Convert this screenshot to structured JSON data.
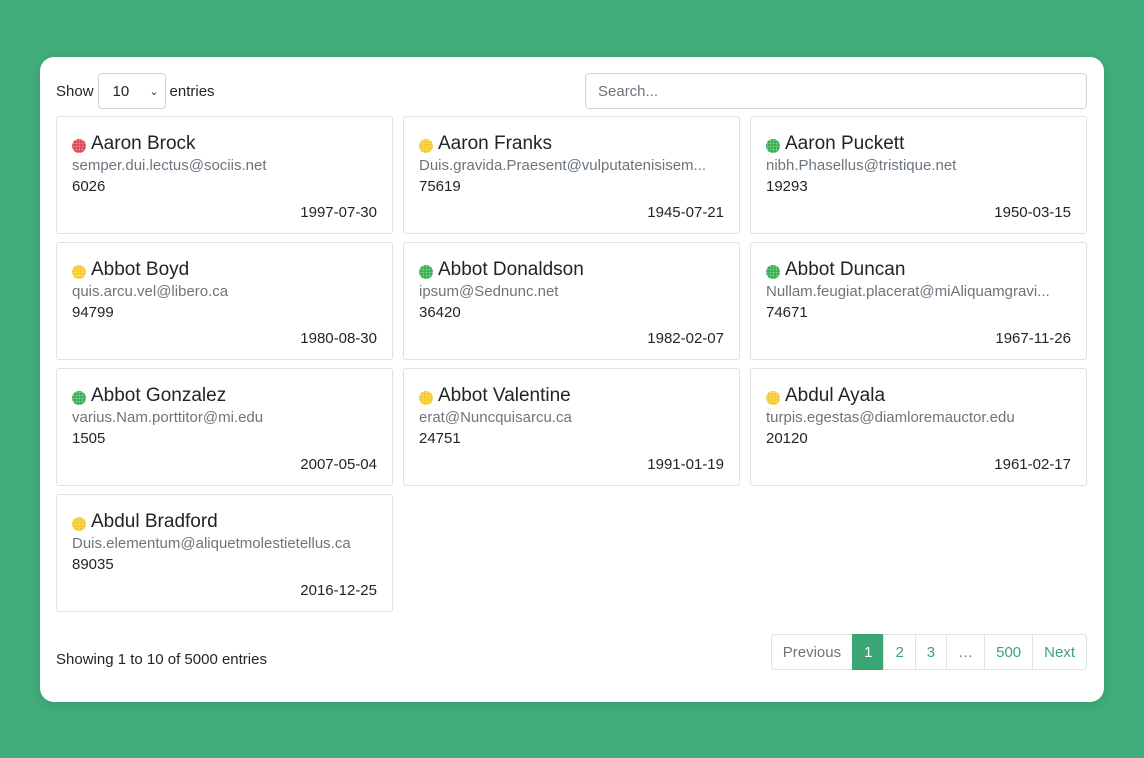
{
  "length": {
    "show_label": "Show",
    "selected": "10",
    "entries_label": "entries"
  },
  "search": {
    "placeholder": "Search..."
  },
  "colors": {
    "red": "#dc3545",
    "yellow": "#f5c518",
    "green": "#28a745",
    "accent": "#3aa675"
  },
  "cards": [
    {
      "name": "Aaron Brock",
      "email": "semper.dui.lectus@sociis.net",
      "number": "6026",
      "date": "1997-07-30",
      "status": "red"
    },
    {
      "name": "Aaron Franks",
      "email": "Duis.gravida.Praesent@vulputatenisisem...",
      "number": "75619",
      "date": "1945-07-21",
      "status": "yellow"
    },
    {
      "name": "Aaron Puckett",
      "email": "nibh.Phasellus@tristique.net",
      "number": "19293",
      "date": "1950-03-15",
      "status": "green"
    },
    {
      "name": "Abbot Boyd",
      "email": "quis.arcu.vel@libero.ca",
      "number": "94799",
      "date": "1980-08-30",
      "status": "yellow"
    },
    {
      "name": "Abbot Donaldson",
      "email": "ipsum@Sednunc.net",
      "number": "36420",
      "date": "1982-02-07",
      "status": "green"
    },
    {
      "name": "Abbot Duncan",
      "email": "Nullam.feugiat.placerat@miAliquamgravi...",
      "number": "74671",
      "date": "1967-11-26",
      "status": "green"
    },
    {
      "name": "Abbot Gonzalez",
      "email": "varius.Nam.porttitor@mi.edu",
      "number": "1505",
      "date": "2007-05-04",
      "status": "green"
    },
    {
      "name": "Abbot Valentine",
      "email": "erat@Nuncquisarcu.ca",
      "number": "24751",
      "date": "1991-01-19",
      "status": "yellow"
    },
    {
      "name": "Abdul Ayala",
      "email": "turpis.egestas@diamloremauctor.edu",
      "number": "20120",
      "date": "1961-02-17",
      "status": "yellow"
    },
    {
      "name": "Abdul Bradford",
      "email": "Duis.elementum@aliquetmolestietellus.ca",
      "number": "89035",
      "date": "2016-12-25",
      "status": "yellow"
    }
  ],
  "info": "Showing 1 to 10 of 5000 entries",
  "pagination": {
    "previous": "Previous",
    "pages": [
      "1",
      "2",
      "3",
      "…",
      "500"
    ],
    "next": "Next"
  }
}
